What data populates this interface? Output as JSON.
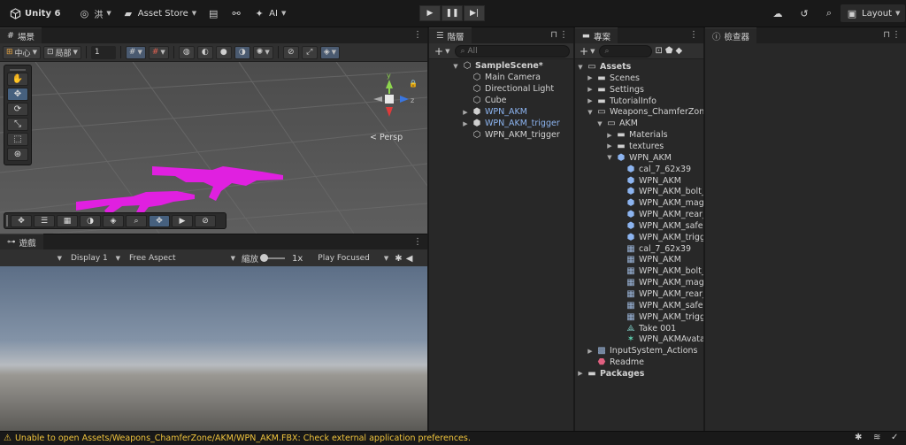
{
  "topbar": {
    "account": "Unity 6",
    "user": "洪",
    "asset_store": "Asset Store",
    "ai": "AI",
    "layout": "Layout"
  },
  "scene": {
    "tab": "場景",
    "pivot": "中心",
    "space": "局部",
    "grid_value": "1",
    "persp": "< Persp"
  },
  "game": {
    "tab": "遊戲",
    "display": "Display 1",
    "aspect": "Free Aspect",
    "scale_label": "縮放",
    "scale_value": "1x",
    "play_mode": "Play Focused"
  },
  "hierarchy": {
    "tab": "階層",
    "search_placeholder": "All",
    "scene_name": "SampleScene*",
    "items": [
      {
        "label": "Main Camera",
        "prefab": false,
        "fold": false
      },
      {
        "label": "Directional Light",
        "prefab": false,
        "fold": false
      },
      {
        "label": "Cube",
        "prefab": false,
        "fold": false
      },
      {
        "label": "WPN_AKM",
        "prefab": true,
        "fold": true
      },
      {
        "label": "WPN_AKM_trigger",
        "prefab": true,
        "fold": true
      },
      {
        "label": "WPN_AKM_trigger",
        "prefab": false,
        "fold": false
      }
    ]
  },
  "project": {
    "tab": "專案",
    "tree": [
      {
        "label": "Assets",
        "depth": 0,
        "fold": "open",
        "icon": "folder-open",
        "bold": true
      },
      {
        "label": "Scenes",
        "depth": 1,
        "fold": "closed",
        "icon": "folder"
      },
      {
        "label": "Settings",
        "depth": 1,
        "fold": "closed",
        "icon": "folder"
      },
      {
        "label": "TutorialInfo",
        "depth": 1,
        "fold": "closed",
        "icon": "folder"
      },
      {
        "label": "Weapons_ChamferZone",
        "depth": 1,
        "fold": "open",
        "icon": "folder-open"
      },
      {
        "label": "AKM",
        "depth": 2,
        "fold": "open",
        "icon": "folder-open"
      },
      {
        "label": "Materials",
        "depth": 3,
        "fold": "closed",
        "icon": "folder"
      },
      {
        "label": "textures",
        "depth": 3,
        "fold": "closed",
        "icon": "folder"
      },
      {
        "label": "WPN_AKM",
        "depth": 3,
        "fold": "open",
        "icon": "model"
      },
      {
        "label": "cal_7_62x39",
        "depth": 4,
        "fold": "",
        "icon": "mesh-cube"
      },
      {
        "label": "WPN_AKM",
        "depth": 4,
        "fold": "",
        "icon": "mesh-cube"
      },
      {
        "label": "WPN_AKM_bolt_",
        "depth": 4,
        "fold": "",
        "icon": "mesh-cube"
      },
      {
        "label": "WPN_AKM_mag",
        "depth": 4,
        "fold": "",
        "icon": "mesh-cube"
      },
      {
        "label": "WPN_AKM_rear_",
        "depth": 4,
        "fold": "",
        "icon": "mesh-cube"
      },
      {
        "label": "WPN_AKM_safe",
        "depth": 4,
        "fold": "",
        "icon": "mesh-cube"
      },
      {
        "label": "WPN_AKM_trigg",
        "depth": 4,
        "fold": "",
        "icon": "mesh-cube"
      },
      {
        "label": "cal_7_62x39",
        "depth": 4,
        "fold": "",
        "icon": "mesh-grid"
      },
      {
        "label": "WPN_AKM",
        "depth": 4,
        "fold": "",
        "icon": "mesh-grid"
      },
      {
        "label": "WPN_AKM_bolt_",
        "depth": 4,
        "fold": "",
        "icon": "mesh-grid"
      },
      {
        "label": "WPN_AKM_mag",
        "depth": 4,
        "fold": "",
        "icon": "mesh-grid"
      },
      {
        "label": "WPN_AKM_rear_",
        "depth": 4,
        "fold": "",
        "icon": "mesh-grid"
      },
      {
        "label": "WPN_AKM_safe",
        "depth": 4,
        "fold": "",
        "icon": "mesh-grid"
      },
      {
        "label": "WPN_AKM_trigg",
        "depth": 4,
        "fold": "",
        "icon": "mesh-grid"
      },
      {
        "label": "Take 001",
        "depth": 4,
        "fold": "",
        "icon": "animation"
      },
      {
        "label": "WPN_AKMAvata",
        "depth": 4,
        "fold": "",
        "icon": "avatar"
      },
      {
        "label": "InputSystem_Actions",
        "depth": 1,
        "fold": "closed",
        "icon": "input-actions"
      },
      {
        "label": "Readme",
        "depth": 1,
        "fold": "",
        "icon": "readme"
      },
      {
        "label": "Packages",
        "depth": 0,
        "fold": "closed",
        "icon": "folder",
        "bold": true
      }
    ]
  },
  "inspector": {
    "tab": "檢查器"
  },
  "status": {
    "message": "Unable to open Assets/Weapons_ChamferZone/AKM/WPN_AKM.FBX: Check external application preferences."
  },
  "colors": {
    "warning": "#f0c43c",
    "prefab_blue": "#8cb4f0",
    "missing_material": "#e020e0"
  }
}
